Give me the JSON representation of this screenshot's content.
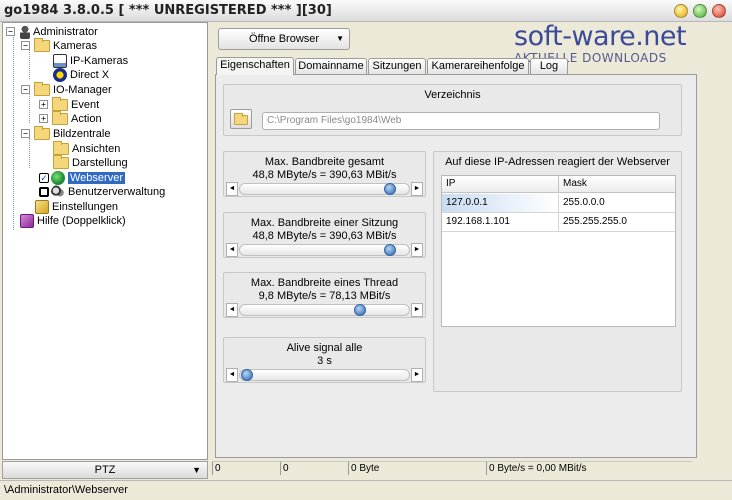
{
  "window": {
    "title": "go1984 3.8.0.5 [ *** UNREGISTERED *** ][30]"
  },
  "watermark": {
    "main": "soft-ware.net",
    "sub": "AKTUELLE DOWNLOADS"
  },
  "tree": {
    "items": [
      {
        "label": "Administrator",
        "icon": "user-icon"
      },
      {
        "label": "Kameras",
        "icon": "folder-icon"
      },
      {
        "label": "IP-Kameras",
        "icon": "network-camera-icon"
      },
      {
        "label": "Direct X",
        "icon": "directx-icon"
      },
      {
        "label": "IO-Manager",
        "icon": "folder-icon"
      },
      {
        "label": "Event",
        "icon": "folder-icon"
      },
      {
        "label": "Action",
        "icon": "folder-icon"
      },
      {
        "label": "Bildzentrale",
        "icon": "folder-icon"
      },
      {
        "label": "Ansichten",
        "icon": "folder-icon"
      },
      {
        "label": "Darstellung",
        "icon": "folder-icon"
      },
      {
        "label": "Webserver",
        "icon": "globe-icon"
      },
      {
        "label": "Benutzerverwaltung",
        "icon": "users-icon"
      },
      {
        "label": "Einstellungen",
        "icon": "settings-icon"
      },
      {
        "label": "Hilfe (Doppelklick)",
        "icon": "help-book-icon"
      }
    ]
  },
  "ptz": {
    "label": "PTZ"
  },
  "statusbar": {
    "path": "\\Administrator\\Webserver"
  },
  "bottom_cells": [
    "0",
    "0",
    "0 Byte",
    "0 Byte/s = 0,00 MBit/s"
  ],
  "toolbar": {
    "open_browser": "Öffne Browser"
  },
  "tabs": [
    "Eigenschaften",
    "Domainname",
    "Sitzungen",
    "Kamerareihenfolge",
    "Log"
  ],
  "directory": {
    "label": "Verzeichnis",
    "path": "C:\\Program Files\\go1984\\Web"
  },
  "sliders": [
    {
      "title": "Max. Bandbreite gesamt",
      "value": "48,8 MByte/s = 390,63 MBit/s",
      "level": 0.92
    },
    {
      "title": "Max. Bandbreite einer Sitzung",
      "value": "48,8 MByte/s = 390,63 MBit/s",
      "level": 0.92
    },
    {
      "title": "Max. Bandbreite eines Thread",
      "value": "9,8 MByte/s = 78,13 MBit/s",
      "level": 0.73
    },
    {
      "title": "Alive signal alle",
      "value": "3 s",
      "level": 0.0
    }
  ],
  "ip_panel": {
    "title": "Auf diese IP-Adressen reagiert der Webserver",
    "columns": [
      "IP",
      "Mask"
    ],
    "rows": [
      [
        "127.0.0.1",
        "255.0.0.0"
      ],
      [
        "192.168.1.101",
        "255.255.255.0"
      ]
    ]
  },
  "colors": {
    "selection": "#316ac5",
    "accent": "#4f86c6",
    "watermark": "#3b4a99"
  }
}
